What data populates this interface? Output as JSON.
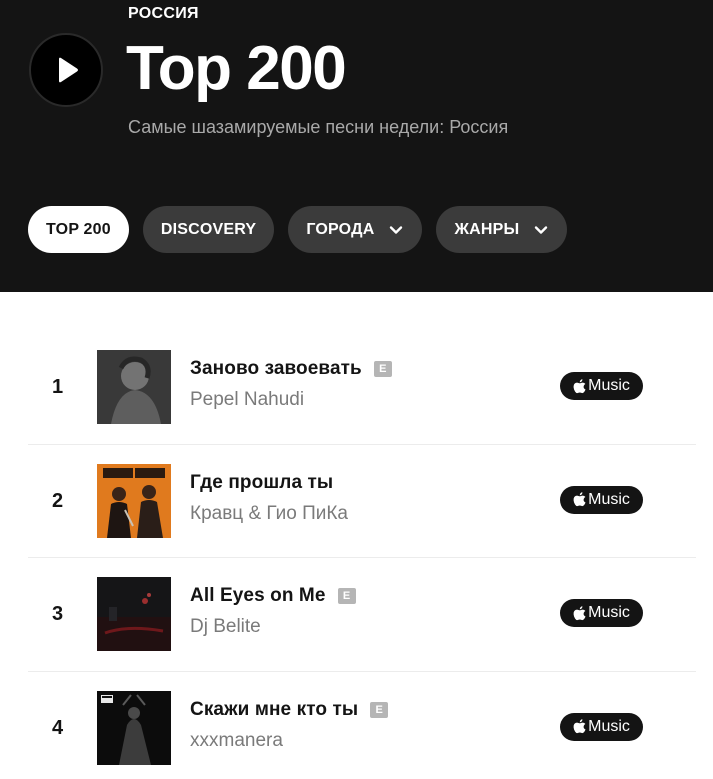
{
  "header": {
    "country": "РОССИЯ",
    "title": "Top 200",
    "subtitle": "Самые шазамируемые песни недели: Россия",
    "play_icon": "play-icon"
  },
  "tabs": [
    {
      "label": "TOP 200",
      "active": true
    },
    {
      "label": "DISCOVERY",
      "active": false
    },
    {
      "label": "ГОРОДА",
      "active": false,
      "icon": "chevron-down-icon"
    },
    {
      "label": "ЖАНРЫ",
      "active": false,
      "icon": "chevron-down-icon"
    }
  ],
  "tracks": [
    {
      "rank": "1",
      "title": "Заново завоевать",
      "explicit": true,
      "explicit_label": "E",
      "artist": "Pepel Nahudi",
      "service_label": "Music"
    },
    {
      "rank": "2",
      "title": "Где прошла ты",
      "explicit": false,
      "explicit_label": "",
      "artist": "Кравц & Гио ПиКа",
      "service_label": "Music"
    },
    {
      "rank": "3",
      "title": "All Eyes on Me",
      "explicit": true,
      "explicit_label": "E",
      "artist": "Dj Belite",
      "service_label": "Music"
    },
    {
      "rank": "4",
      "title": "Скажи мне кто ты",
      "explicit": true,
      "explicit_label": "E",
      "artist": "xxxmanera",
      "service_label": "Music"
    }
  ],
  "colors": {
    "hero_background": "#141414",
    "tab_background": "#3b3b3b",
    "explicit_badge": "#b5b5b5",
    "artist_text": "#7a7a7a"
  }
}
